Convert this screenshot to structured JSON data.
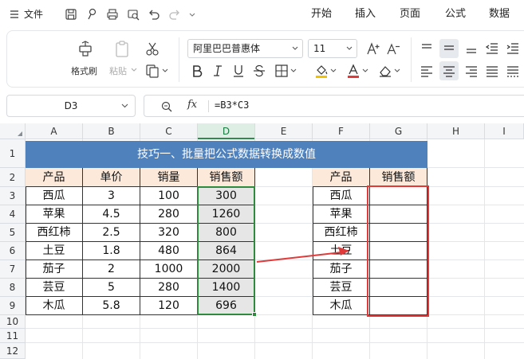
{
  "menu": {
    "hamburger_icon": "menu-icon",
    "file_label": "文件"
  },
  "tabs": [
    {
      "label": "开始",
      "active": true
    },
    {
      "label": "插入",
      "active": false
    },
    {
      "label": "页面",
      "active": false
    },
    {
      "label": "公式",
      "active": false
    },
    {
      "label": "数据",
      "active": false
    }
  ],
  "ribbon": {
    "format_painter_label": "格式刷",
    "paste_label": "粘贴",
    "font_name": "阿里巴巴普惠体",
    "font_size": "11"
  },
  "formula_bar": {
    "name_box": "D3",
    "fx_label": "fx",
    "formula": "=B3*C3"
  },
  "columns": [
    "A",
    "B",
    "C",
    "D",
    "E",
    "F",
    "G",
    "H",
    "I"
  ],
  "active_column": "D",
  "rows": [
    "1",
    "2",
    "3",
    "4",
    "5",
    "6",
    "7",
    "8",
    "9",
    "10",
    "11",
    "12"
  ],
  "title": "技巧一、批量把公式数据转换成数值",
  "left_table": {
    "headers": [
      "产品",
      "单价",
      "销量",
      "销售额"
    ],
    "rows": [
      [
        "西瓜",
        "3",
        "100",
        "300"
      ],
      [
        "苹果",
        "4.5",
        "280",
        "1260"
      ],
      [
        "西红柿",
        "2.5",
        "320",
        "800"
      ],
      [
        "土豆",
        "1.8",
        "480",
        "864"
      ],
      [
        "茄子",
        "2",
        "1000",
        "2000"
      ],
      [
        "芸豆",
        "5",
        "280",
        "1400"
      ],
      [
        "木瓜",
        "5.8",
        "120",
        "696"
      ]
    ]
  },
  "right_table": {
    "headers": [
      "产品",
      "销售额"
    ],
    "products": [
      "西瓜",
      "苹果",
      "西红柿",
      "土豆",
      "茄子",
      "芸豆",
      "木瓜"
    ]
  },
  "colors": {
    "accent_green": "#1a8a4a",
    "title_band": "#4f81bd",
    "header_fill": "#fde9d9",
    "selection": "#2e8b3e",
    "highlight_red": "#e03a3a"
  }
}
